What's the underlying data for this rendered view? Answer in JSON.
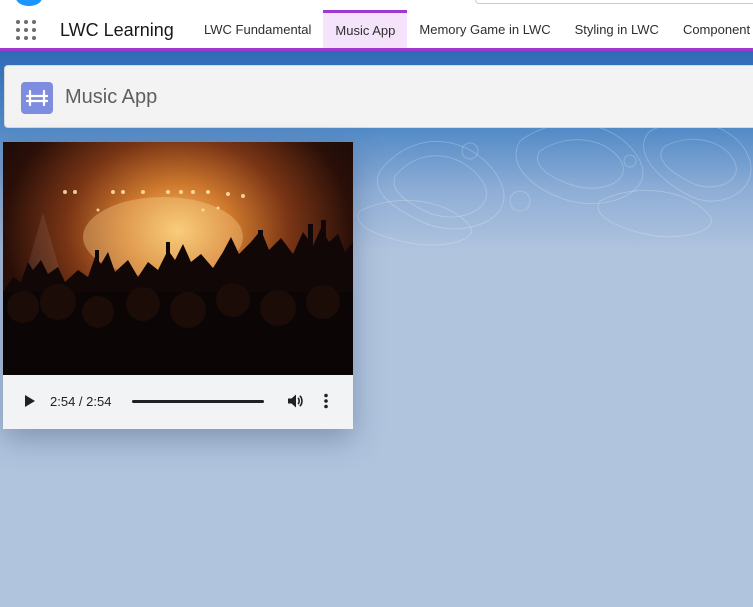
{
  "app": {
    "name": "LWC Learning"
  },
  "nav": {
    "tabs": [
      {
        "label": "LWC Fundamental",
        "active": false
      },
      {
        "label": "Music App",
        "active": true
      },
      {
        "label": "Memory Game in LWC",
        "active": false
      },
      {
        "label": "Styling in LWC",
        "active": false
      },
      {
        "label": "Component c",
        "active": false
      }
    ]
  },
  "page": {
    "title": "Music App",
    "icon": "custom-app-icon"
  },
  "player": {
    "time": "2:54 / 2:54",
    "progress": 1.0,
    "icons": [
      "play-icon",
      "volume-icon",
      "more-options-icon"
    ]
  },
  "colors": {
    "accent": "#9e38cf",
    "active_tab_bg": "#f4e3fb",
    "page_bg": "#b0c4de",
    "header_icon": "#7f8de1"
  }
}
